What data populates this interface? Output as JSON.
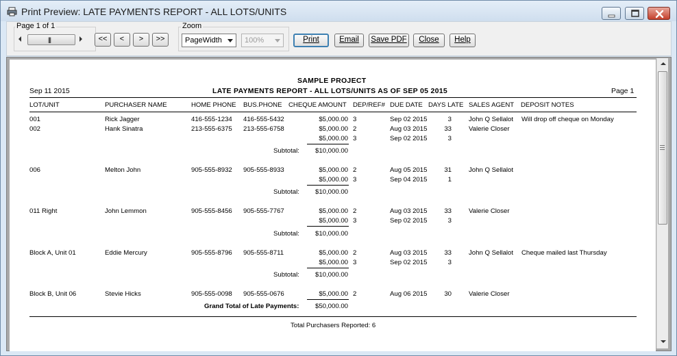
{
  "window": {
    "title": "Print Preview: LATE PAYMENTS REPORT - ALL LOTS/UNITS",
    "app_icon": "printer-icon"
  },
  "toolbar": {
    "page_indicator": "Page 1 of 1",
    "nav": {
      "first": "<<",
      "prev": "<",
      "next": ">",
      "last": ">>"
    },
    "zoom_label": "Zoom",
    "zoom_mode": "PageWidth",
    "zoom_percent": "100%",
    "print_label": "Print",
    "email_label": "Email",
    "save_pdf_label": "Save PDF",
    "close_label": "Close",
    "help_label": "Help"
  },
  "report": {
    "project": "SAMPLE PROJECT",
    "date": "Sep 11 2015",
    "title": "LATE PAYMENTS REPORT - ALL LOTS/UNITS AS OF SEP 05 2015",
    "page": "Page 1",
    "columns": {
      "lot": "LOT/UNIT",
      "purchaser": "PURCHASER NAME",
      "home_phone": "HOME PHONE",
      "bus_phone": "BUS.PHONE",
      "cheque": "CHEQUE AMOUNT",
      "dep": "DEP/REF#",
      "due": "DUE DATE",
      "days": "DAYS LATE",
      "agent": "SALES AGENT",
      "notes": "DEPOSIT NOTES"
    },
    "rows": [
      {
        "lot": "001",
        "purchaser": "Rick Jagger",
        "home": "416-555-1234",
        "bus": "416-555-5432",
        "amount": "$5,000.00",
        "dep": "3",
        "due": "Sep 02 2015",
        "days": "3",
        "agent": "John Q Sellalot",
        "notes": "Will drop off cheque on Monday"
      },
      {
        "lot": "002",
        "purchaser": "Hank Sinatra",
        "home": "213-555-6375",
        "bus": "213-555-6758",
        "amount": "$5,000.00",
        "dep": "2",
        "due": "Aug 03 2015",
        "days": "33",
        "agent": "Valerie Closer",
        "notes": ""
      },
      {
        "lot": "",
        "purchaser": "",
        "home": "",
        "bus": "",
        "amount": "$5,000.00",
        "dep": "3",
        "due": "Sep 02 2015",
        "days": "3",
        "agent": "",
        "notes": ""
      },
      {
        "lot": "006",
        "purchaser": "Melton John",
        "home": "905-555-8932",
        "bus": "905-555-8933",
        "amount": "$5,000.00",
        "dep": "2",
        "due": "Aug 05 2015",
        "days": "31",
        "agent": "John Q Sellalot",
        "notes": ""
      },
      {
        "lot": "",
        "purchaser": "",
        "home": "",
        "bus": "",
        "amount": "$5,000.00",
        "dep": "3",
        "due": "Sep 04 2015",
        "days": "1",
        "agent": "",
        "notes": ""
      },
      {
        "lot": "011 Right",
        "purchaser": "John Lemmon",
        "home": "905-555-8456",
        "bus": "905-555-7767",
        "amount": "$5,000.00",
        "dep": "2",
        "due": "Aug 03 2015",
        "days": "33",
        "agent": "Valerie Closer",
        "notes": ""
      },
      {
        "lot": "",
        "purchaser": "",
        "home": "",
        "bus": "",
        "amount": "$5,000.00",
        "dep": "3",
        "due": "Sep 02 2015",
        "days": "3",
        "agent": "",
        "notes": ""
      },
      {
        "lot": "Block A, Unit 01",
        "purchaser": "Eddie Mercury",
        "home": "905-555-8796",
        "bus": "905-555-8711",
        "amount": "$5,000.00",
        "dep": "2",
        "due": "Aug 03 2015",
        "days": "33",
        "agent": "John Q Sellalot",
        "notes": "Cheque mailed last Thursday"
      },
      {
        "lot": "",
        "purchaser": "",
        "home": "",
        "bus": "",
        "amount": "$5,000.00",
        "dep": "3",
        "due": "Sep 02 2015",
        "days": "3",
        "agent": "",
        "notes": ""
      },
      {
        "lot": "Block B, Unit 06",
        "purchaser": "Stevie Hicks",
        "home": "905-555-0098",
        "bus": "905-555-0676",
        "amount": "$5,000.00",
        "dep": "2",
        "due": "Aug 06 2015",
        "days": "30",
        "agent": "Valerie Closer",
        "notes": ""
      }
    ],
    "subtotal_label": "Subtotal:",
    "subtotals": [
      "$10,000.00",
      "$10,000.00",
      "$10,000.00",
      "$10,000.00"
    ],
    "grand_total_label": "Grand Total of Late Payments:",
    "grand_total": "$50,000.00",
    "footer": "Total Purchasers Reported: 6"
  }
}
